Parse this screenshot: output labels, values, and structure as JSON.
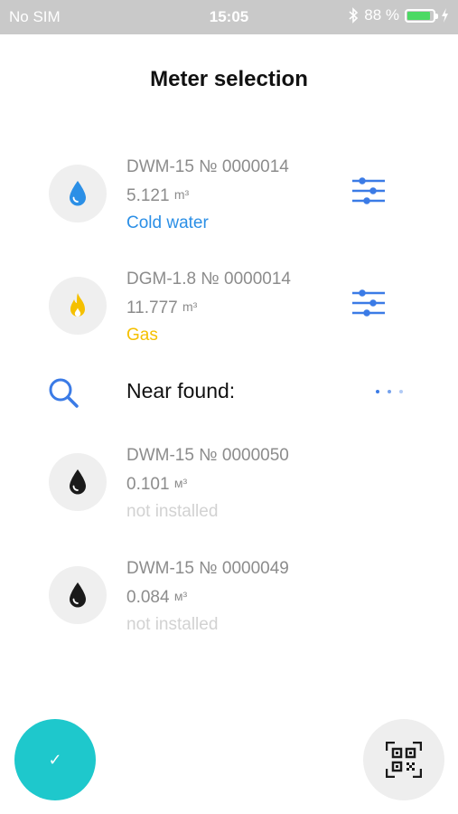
{
  "status_bar": {
    "carrier": "No SIM",
    "time": "15:05",
    "battery_percent": "88 %",
    "battery_level": 0.88,
    "icons": [
      "bluetooth-icon",
      "battery-icon",
      "charging-icon"
    ]
  },
  "title": "Meter selection",
  "colors": {
    "water_blue": "#2b8fe6",
    "gas_yellow": "#f5c000",
    "accent_blue": "#3b7be6",
    "confirm_teal": "#1ec8cc",
    "gray_text": "#8c8c8c",
    "muted_text": "#d2d2d2"
  },
  "meters": [
    {
      "model": "DWM-15 № 0000014",
      "value": "5.121",
      "unit": "m³",
      "type": "Cold water",
      "icon": "water-drop-icon"
    },
    {
      "model": "DGM-1.8 № 0000014",
      "value": "11.777",
      "unit": "m³",
      "type": "Gas",
      "icon": "flame-icon"
    }
  ],
  "near": {
    "label": "Near found:",
    "items": [
      {
        "model": "DWM-15 № 0000050",
        "value": "0.101",
        "unit": "м³",
        "status": "not installed",
        "icon": "water-drop-icon"
      },
      {
        "model": "DWM-15 № 0000049",
        "value": "0.084",
        "unit": "м³",
        "status": "not installed",
        "icon": "water-drop-icon"
      }
    ]
  },
  "actions": {
    "confirm_icon": "✓",
    "qr_icon": "qr-code-icon"
  }
}
